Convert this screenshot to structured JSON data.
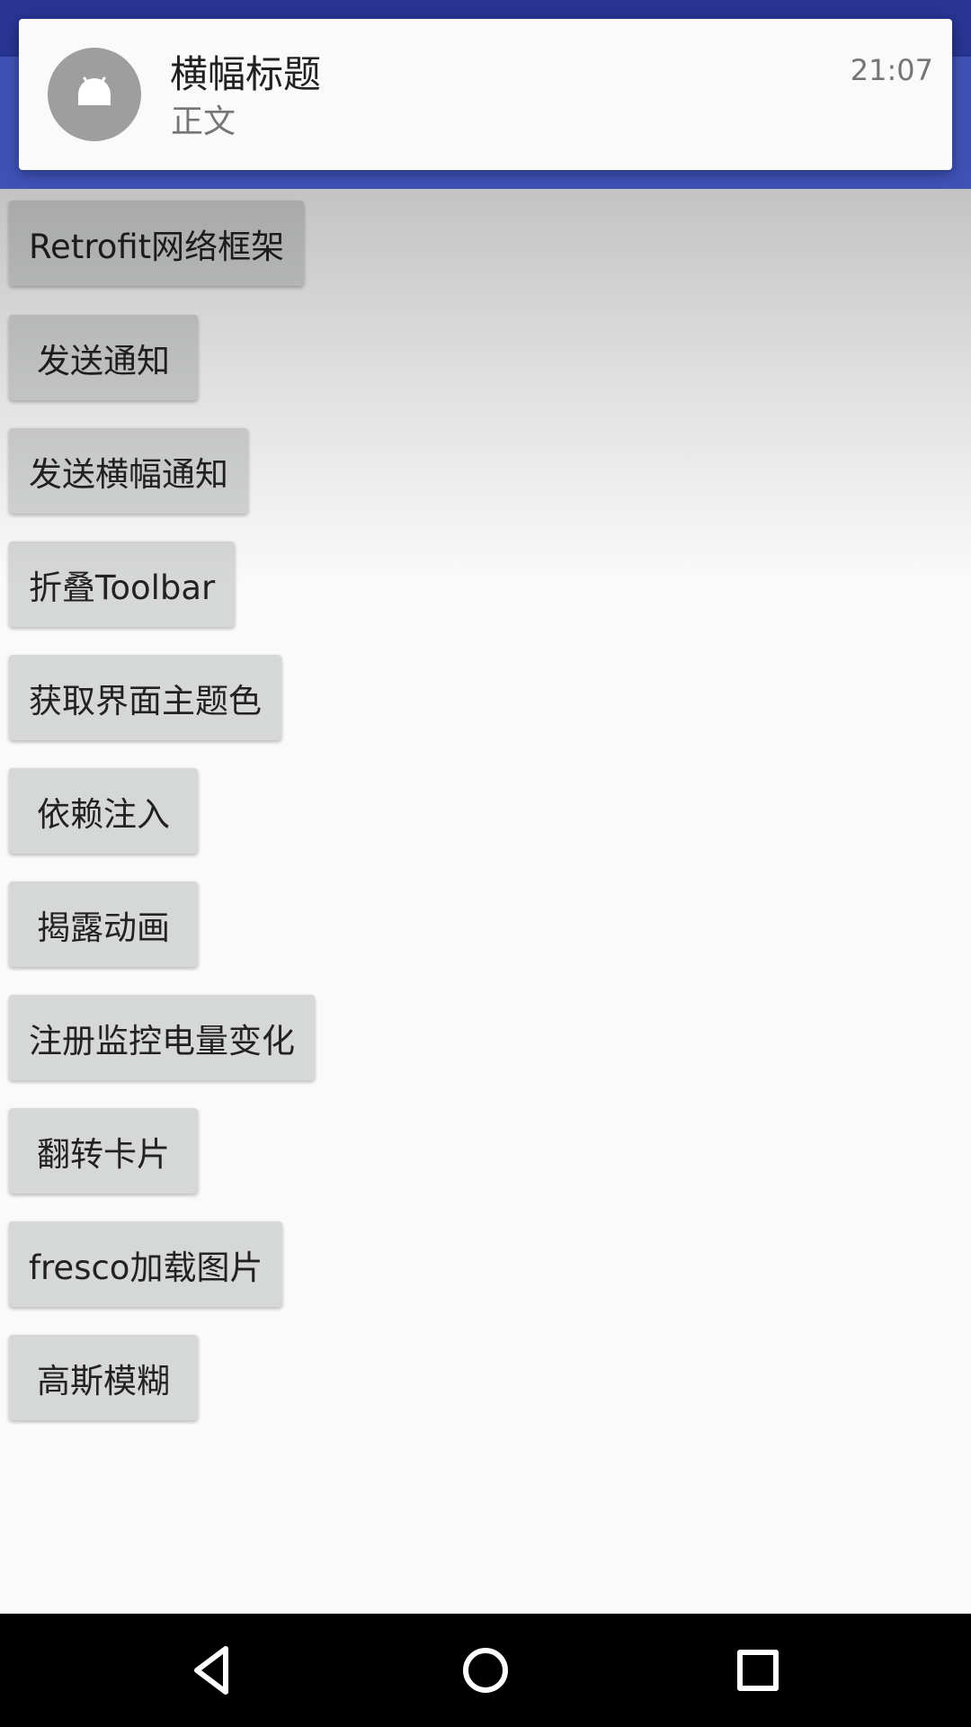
{
  "notification": {
    "title": "横幅标题",
    "body": "正文",
    "time": "21:07",
    "icon": "android-icon"
  },
  "buttons": [
    {
      "label": "Retrofit网络框架"
    },
    {
      "label": "发送通知"
    },
    {
      "label": "发送横幅通知"
    },
    {
      "label": "折叠Toolbar"
    },
    {
      "label": "获取界面主题色"
    },
    {
      "label": "依赖注入"
    },
    {
      "label": "揭露动画"
    },
    {
      "label": "注册监控电量变化"
    },
    {
      "label": "翻转卡片"
    },
    {
      "label": "fresco加载图片"
    },
    {
      "label": "高斯模糊"
    }
  ],
  "navigation": {
    "back_icon": "back-triangle-icon",
    "home_icon": "home-circle-icon",
    "recents_icon": "recents-square-icon"
  },
  "colors": {
    "status_bar": "#283593",
    "app_bar": "#3f51b5",
    "button_bg": "#d6d7d7",
    "background": "#fafafa"
  }
}
